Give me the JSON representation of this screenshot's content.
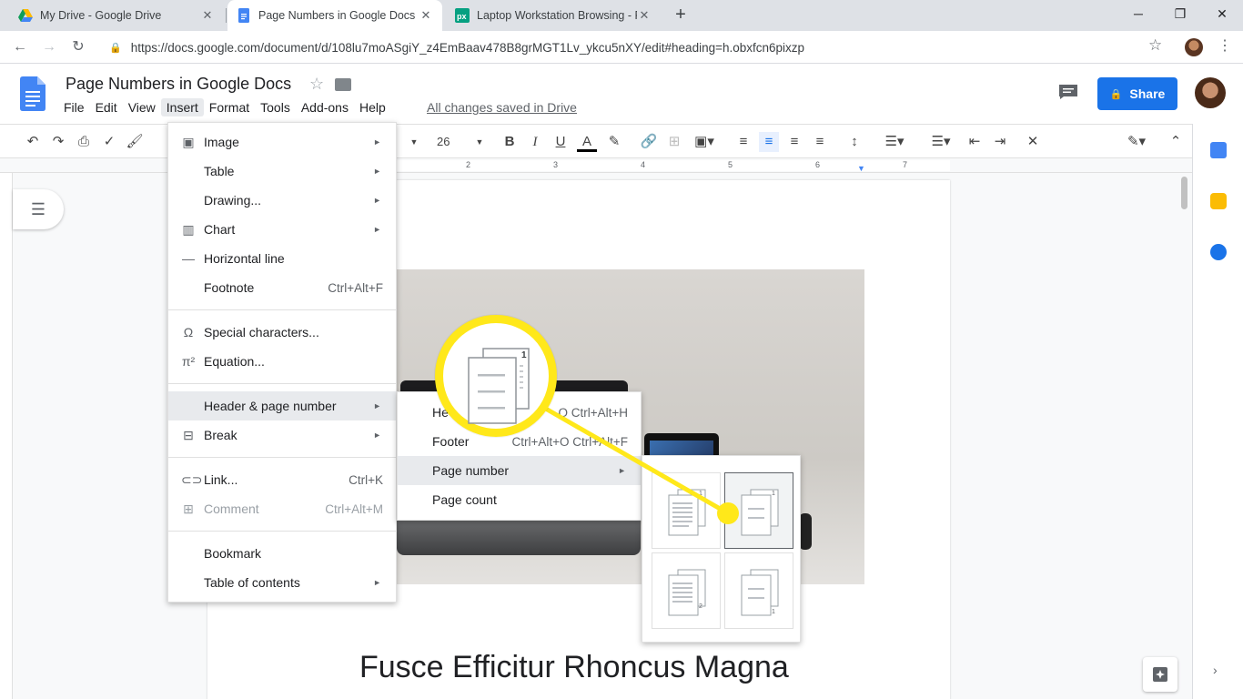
{
  "browser": {
    "tabs": [
      {
        "title": "My Drive - Google Drive",
        "close": "✕"
      },
      {
        "title": "Page Numbers in Google Docs -",
        "close": "✕"
      },
      {
        "title": "Laptop Workstation Browsing - F",
        "close": "✕"
      }
    ],
    "new_tab": "+",
    "window_controls": {
      "minimize": "─",
      "maximize": "❐",
      "close": "✕"
    },
    "url": "https://docs.google.com/document/d/108lu7moASgiY_z4EmBaav478B8grMGT1Lv_ykcu5nXY/edit#heading=h.obxfcn6pixzp"
  },
  "docs": {
    "title": "Page Numbers in Google Docs",
    "menu": [
      "File",
      "Edit",
      "View",
      "Insert",
      "Format",
      "Tools",
      "Add-ons",
      "Help"
    ],
    "saved_status": "All changes saved in Drive",
    "share_label": "Share",
    "font_size": "26",
    "ruler_numbers": [
      "2",
      "3",
      "4",
      "5",
      "6",
      "7"
    ],
    "heading": "Fusce Efficitur Rhoncus Magna"
  },
  "insert_menu": {
    "items": [
      {
        "label": "Image",
        "icon": "image-icon",
        "shortcut": "",
        "arrow": true
      },
      {
        "label": "Table",
        "icon": "",
        "shortcut": "",
        "arrow": true
      },
      {
        "label": "Drawing...",
        "icon": "",
        "shortcut": "",
        "arrow": true
      },
      {
        "label": "Chart",
        "icon": "chart-icon",
        "shortcut": "",
        "arrow": true
      },
      {
        "label": "Horizontal line",
        "icon": "horizontal-line-icon",
        "shortcut": "",
        "arrow": false
      },
      {
        "label": "Footnote",
        "icon": "",
        "shortcut": "Ctrl+Alt+F",
        "arrow": false
      },
      {
        "label": "Special characters...",
        "icon": "omega-icon",
        "shortcut": "",
        "arrow": false
      },
      {
        "label": "Equation...",
        "icon": "pi-icon",
        "shortcut": "",
        "arrow": false
      },
      {
        "label": "Header & page number",
        "icon": "",
        "shortcut": "",
        "arrow": true
      },
      {
        "label": "Break",
        "icon": "break-icon",
        "shortcut": "",
        "arrow": true
      },
      {
        "label": "Link...",
        "icon": "link-icon",
        "shortcut": "Ctrl+K",
        "arrow": false
      },
      {
        "label": "Comment",
        "icon": "comment-add-icon",
        "shortcut": "Ctrl+Alt+M",
        "arrow": false
      },
      {
        "label": "Bookmark",
        "icon": "",
        "shortcut": "",
        "arrow": false
      },
      {
        "label": "Table of contents",
        "icon": "",
        "shortcut": "",
        "arrow": true
      }
    ],
    "arrow_glyph": "►"
  },
  "header_submenu": {
    "items": [
      {
        "label": "He",
        "shortcut": "O Ctrl+Alt+H"
      },
      {
        "label": "Footer",
        "shortcut": "Ctrl+Alt+O Ctrl+Alt+F"
      },
      {
        "label": "Page number",
        "shortcut": "►"
      },
      {
        "label": "Page count",
        "shortcut": ""
      }
    ]
  },
  "page_number_options": {
    "options": [
      {
        "name": "page-number-top-right-all-pages-option",
        "number": "1"
      },
      {
        "name": "page-number-top-right-skip-first-option",
        "number": "1"
      },
      {
        "name": "page-number-bottom-right-all-pages-option",
        "number": "2"
      },
      {
        "name": "page-number-bottom-right-skip-first-option",
        "number": "1"
      }
    ],
    "selected_index": 1
  },
  "colors": {
    "accent_blue": "#1a73e8",
    "callout_yellow": "#ffe81a",
    "docs_blue": "#4285f4"
  }
}
